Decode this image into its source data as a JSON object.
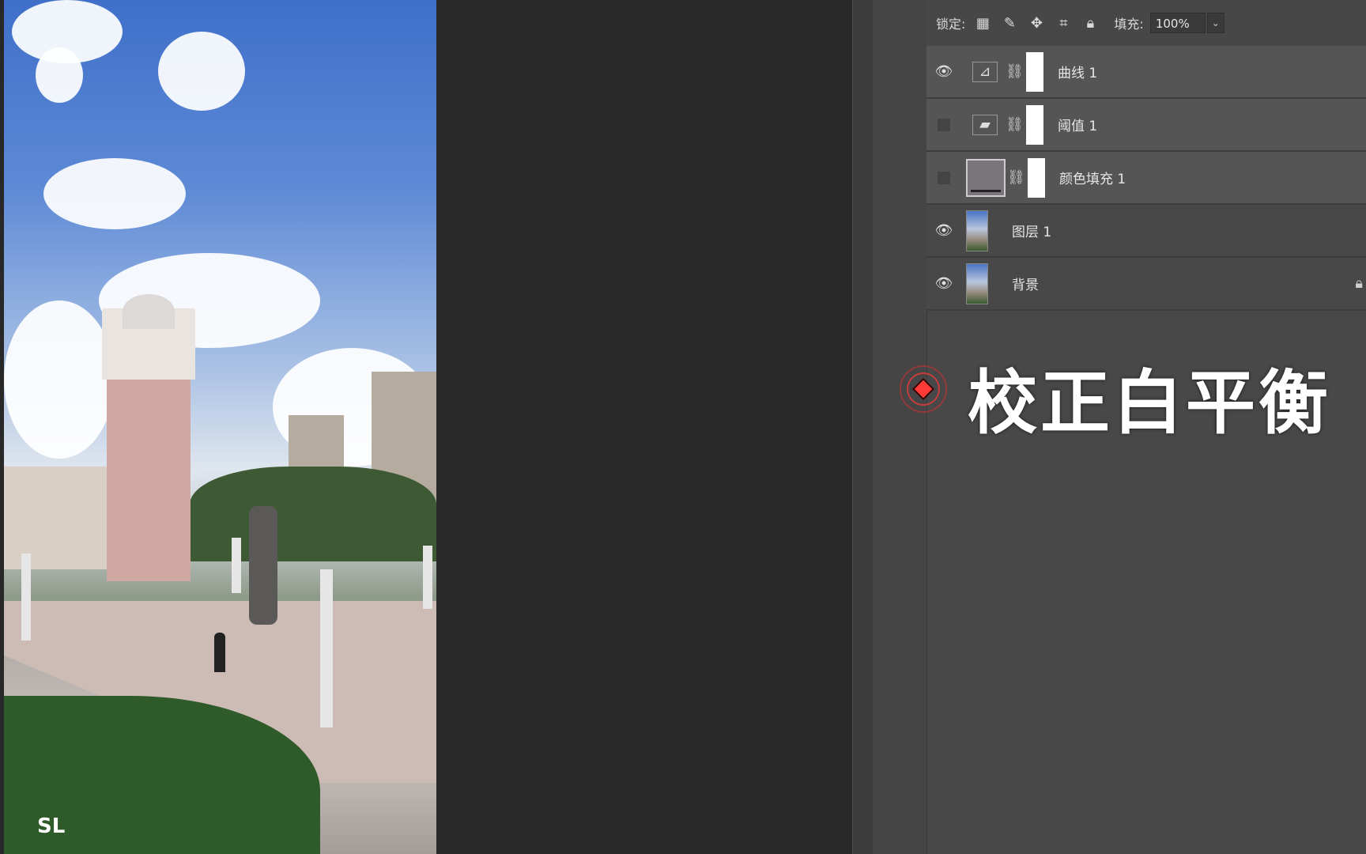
{
  "lock_bar": {
    "lock_label": "锁定:",
    "fill_label": "填充:",
    "fill_value": "100%",
    "icons": [
      "lock-transparent-icon",
      "lock-brush-icon",
      "lock-move-icon",
      "lock-artboard-icon",
      "lock-all-icon"
    ]
  },
  "layers": [
    {
      "name": "曲线 1",
      "type": "adjustment",
      "visible": true,
      "icon": "curves-icon"
    },
    {
      "name": "阈值 1",
      "type": "adjustment",
      "visible": false,
      "icon": "threshold-icon"
    },
    {
      "name": "颜色填充 1",
      "type": "fill",
      "visible": false,
      "icon": "color-fill-thumb",
      "fill_color": "#7a757a"
    },
    {
      "name": "图层 1",
      "type": "pixel",
      "visible": true,
      "icon": "photo-thumb"
    },
    {
      "name": "背景",
      "type": "background",
      "visible": true,
      "icon": "photo-thumb",
      "locked": true
    }
  ],
  "caption": "校正白平衡",
  "watermark": "SL",
  "colors": {
    "panel_bg": "#484848",
    "adjustment_row_bg": "#555555",
    "annotation_red": "#ff3838"
  }
}
